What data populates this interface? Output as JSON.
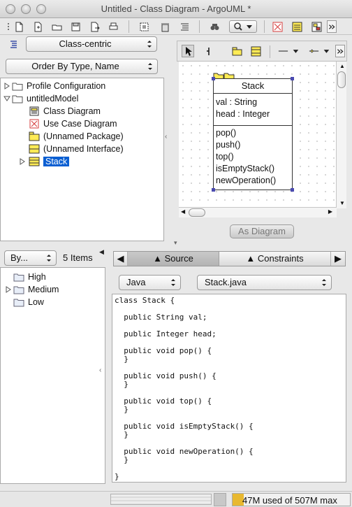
{
  "window": {
    "title": "Untitled - Class Diagram - ArgoUML *"
  },
  "toolbar": {
    "icons": [
      "new-project-icon",
      "new-from-template-icon",
      "open-project-icon",
      "save-icon",
      "export-icon",
      "print-icon",
      "find-in-diagram-icon",
      "delete-icon",
      "layout-icon",
      "search-icon",
      "zoom-icon",
      "overflow-icon",
      "diagram-red-icon",
      "diagram-yellow-icon",
      "diagram-link-icon"
    ]
  },
  "explorer": {
    "perspective": "Class-centric",
    "order": "Order By Type, Name",
    "tree": [
      {
        "label": "Profile Configuration",
        "level": 0,
        "icon": "folder-icon",
        "expander": "collapsed"
      },
      {
        "label": "untitledModel",
        "level": 0,
        "icon": "folder-icon",
        "expander": "expanded"
      },
      {
        "label": "Class Diagram",
        "level": 1,
        "icon": "class-diagram-icon",
        "expander": "none"
      },
      {
        "label": "Use Case Diagram",
        "level": 1,
        "icon": "use-case-diagram-icon",
        "expander": "none"
      },
      {
        "label": "(Unnamed Package)",
        "level": 1,
        "icon": "package-icon",
        "expander": "none"
      },
      {
        "label": "(Unnamed Interface)",
        "level": 1,
        "icon": "interface-icon",
        "expander": "none"
      },
      {
        "label": "Stack",
        "level": 1,
        "icon": "class-icon",
        "expander": "collapsed",
        "selected": true
      }
    ]
  },
  "diagram": {
    "class": {
      "name": "Stack",
      "attributes": [
        "val : String",
        "head : Integer"
      ],
      "operations": [
        "pop()",
        "push()",
        "top()",
        "isEmptyStack()",
        "newOperation()"
      ]
    },
    "as_diagram_button": "As Diagram"
  },
  "todo": {
    "sort": "By...",
    "count": "5 Items",
    "items": [
      {
        "label": "High",
        "expander": "none"
      },
      {
        "label": "Medium",
        "expander": "collapsed"
      },
      {
        "label": "Low",
        "expander": "none"
      }
    ]
  },
  "details": {
    "tabs": [
      "Source",
      "Constraints"
    ],
    "language": "Java",
    "file": "Stack.java",
    "source": "class Stack {\n\n  public String val;\n\n  public Integer head;\n\n  public void pop() {\n  }\n\n  public void push() {\n  }\n\n  public void top() {\n  }\n\n  public void isEmptyStack() {\n  }\n\n  public void newOperation() {\n  }\n\n}"
  },
  "status": {
    "memory": "47M used of 507M max",
    "memory_used_fraction": 0.093
  },
  "colors": {
    "selection": "#0b5fd2",
    "folder": "#ffe14d",
    "class_icon": "#ffeb55",
    "diagram_red": "#d63b3b"
  }
}
